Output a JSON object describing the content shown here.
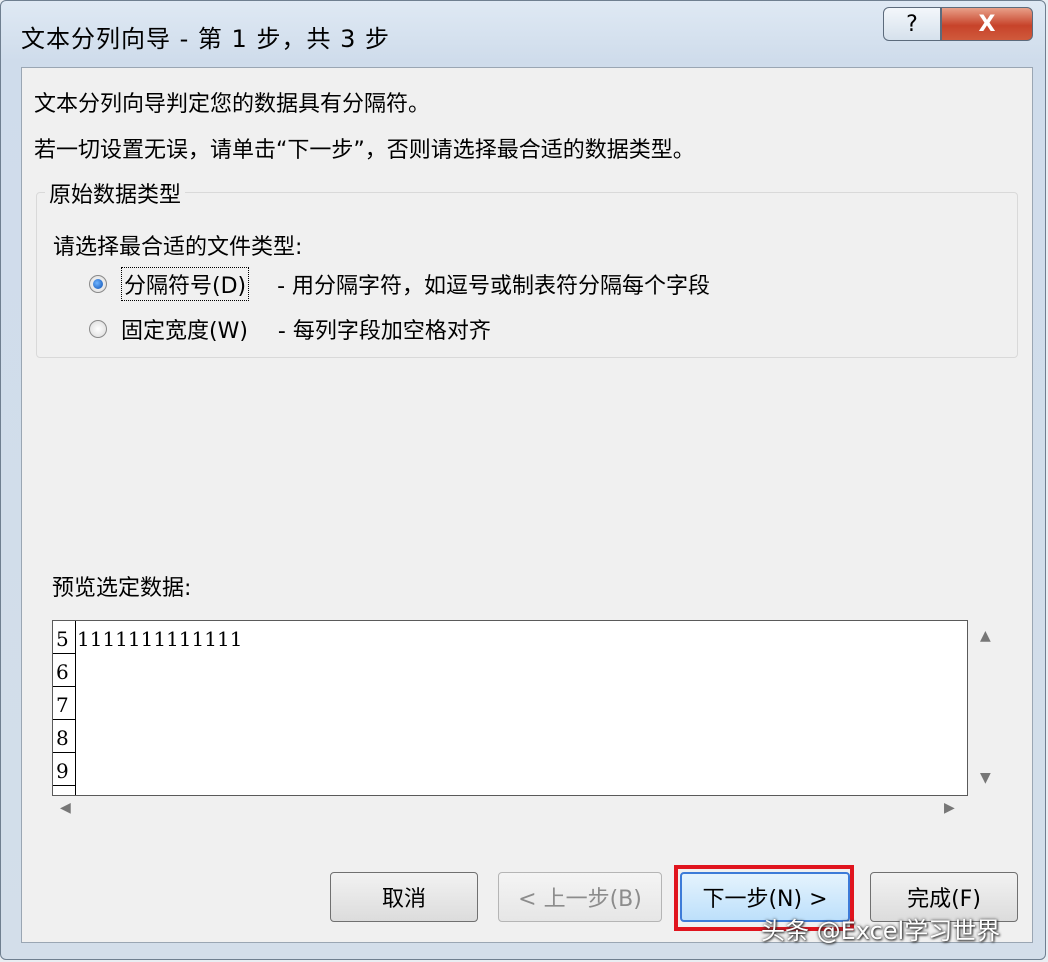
{
  "window": {
    "title": "文本分列向导 - 第 1 步，共 3 步",
    "help_label": "?",
    "close_label": "X"
  },
  "intro": {
    "line1": "文本分列向导判定您的数据具有分隔符。",
    "line2": "若一切设置无误，请单击“下一步”，否则请选择最合适的数据类型。"
  },
  "data_type_group": {
    "legend": "原始数据类型",
    "prompt": "请选择最合适的文件类型:",
    "options": [
      {
        "label": "分隔符号(D)",
        "description": "- 用分隔字符，如逗号或制表符分隔每个字段",
        "checked": true
      },
      {
        "label": "固定宽度(W)",
        "description": "- 每列字段加空格对齐",
        "checked": false
      }
    ]
  },
  "preview": {
    "label": "预览选定数据:",
    "row_numbers": [
      "5",
      "6",
      "7",
      "8",
      "9"
    ],
    "first_row_text": "1111111111111"
  },
  "buttons": {
    "cancel": "取消",
    "back": "< 上一步(B)",
    "next": "下一步(N) >",
    "finish": "完成(F)"
  },
  "watermark": "头条 @Excel学习世界",
  "colors": {
    "highlight": "#e0141e",
    "default_button_border": "#3d7bd8"
  }
}
